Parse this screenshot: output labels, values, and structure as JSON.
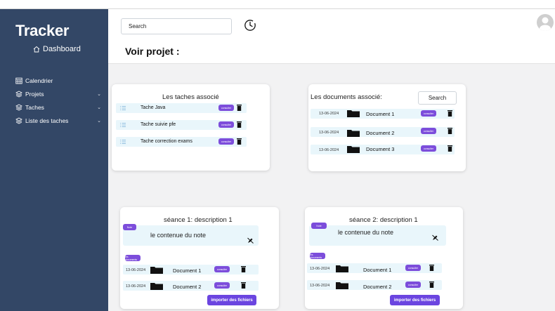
{
  "app": {
    "title": "Tracker",
    "dashboard_label": "Dashboard"
  },
  "sidebar": {
    "items": [
      {
        "label": "Calendrier",
        "icon": "calendar-icon",
        "has_chevron": false
      },
      {
        "label": "Projets",
        "icon": "layers-icon",
        "has_chevron": true
      },
      {
        "label": "Taches",
        "icon": "layers-icon",
        "has_chevron": true
      },
      {
        "label": "Liste des taches",
        "icon": "layers-icon",
        "has_chevron": true
      }
    ]
  },
  "header": {
    "search_placeholder": "Search",
    "page_title": "Voir projet :"
  },
  "tasks_card": {
    "title": "Les taches associé",
    "consult_label": "consulter",
    "tasks": [
      "Tache Java",
      "Tache suivie pfe",
      "Tache correction exams"
    ]
  },
  "documents_card": {
    "title": "Les documents associé:",
    "search_label": "Search",
    "consult_label": "consulter",
    "documents": [
      {
        "date": "13-06-2024",
        "name": "Document 1"
      },
      {
        "date": "13-06-2024",
        "name": "Document 2"
      },
      {
        "date": "13-06-2024",
        "name": "Document 3"
      }
    ]
  },
  "sessions": [
    {
      "title": "séance 1: description 1",
      "note_tag": "Note",
      "note_text": "le contenue du note",
      "docs_tag": "les documents",
      "consult_label": "consulter",
      "documents": [
        {
          "date": "13-06-2024",
          "name": "Document 1"
        },
        {
          "date": "13-06-2024",
          "name": "Document 2"
        }
      ],
      "import_label": "importer des fichiers"
    },
    {
      "title": "séance 2: description 1",
      "note_tag": "Note",
      "note_text": "le contenue du note",
      "docs_tag": "les documents",
      "consult_label": "consulter",
      "documents": [
        {
          "date": "13-06-2024",
          "name": "Document 1"
        },
        {
          "date": "13-06-2024",
          "name": "Document 2"
        }
      ],
      "import_label": "importer des fichiers"
    }
  ],
  "colors": {
    "sidebar": "#334766",
    "accent": "#7c4ddb",
    "row": "#e9f6fb",
    "background": "#f2f2f3"
  }
}
